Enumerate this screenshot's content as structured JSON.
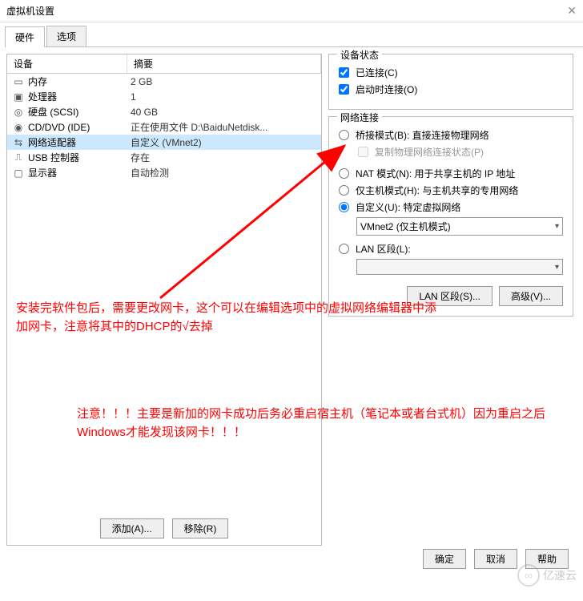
{
  "title": "虚拟机设置",
  "tabs": {
    "hardware": "硬件",
    "options": "选项"
  },
  "table": {
    "device_header": "设备",
    "summary_header": "摘要"
  },
  "hardware": [
    {
      "icon": "memory-icon",
      "name": "内存",
      "summary": "2 GB"
    },
    {
      "icon": "cpu-icon",
      "name": "处理器",
      "summary": "1"
    },
    {
      "icon": "disk-icon",
      "name": "硬盘 (SCSI)",
      "summary": "40 GB"
    },
    {
      "icon": "cd-icon",
      "name": "CD/DVD (IDE)",
      "summary": "正在使用文件 D:\\BaiduNetdisk..."
    },
    {
      "icon": "network-icon",
      "name": "网络适配器",
      "summary": "自定义 (VMnet2)",
      "selected": true
    },
    {
      "icon": "usb-icon",
      "name": "USB 控制器",
      "summary": "存在"
    },
    {
      "icon": "display-icon",
      "name": "显示器",
      "summary": "自动检测"
    }
  ],
  "left_buttons": {
    "add": "添加(A)...",
    "remove": "移除(R)"
  },
  "device_status": {
    "group_title": "设备状态",
    "connected": "已连接(C)",
    "connect_at_power_on": "启动时连接(O)"
  },
  "network": {
    "group_title": "网络连接",
    "bridged": "桥接模式(B): 直接连接物理网络",
    "replicate": "复制物理网络连接状态(P)",
    "nat": "NAT 模式(N): 用于共享主机的 IP 地址",
    "host_only": "仅主机模式(H): 与主机共享的专用网络",
    "custom": "自定义(U): 特定虚拟网络",
    "vmnet_selected": "VMnet2 (仅主机模式)",
    "lan_segment": "LAN 区段(L):",
    "lan_segment_btn": "LAN 区段(S)...",
    "advanced_btn": "高级(V)..."
  },
  "footer": {
    "ok": "确定",
    "cancel": "取消",
    "help": "帮助"
  },
  "annotations": {
    "a1": "安装完软件包后，需要更改网卡，这个可以在编辑选项中的虚拟网络编辑器中添加网卡，注意将其中的DHCP的√去掉",
    "a2": "注意！！！主要是新加的网卡成功后务必重启宿主机（笔记本或者台式机）因为重启之后Windows才能发现该网卡！！！"
  },
  "watermark": "亿速云"
}
